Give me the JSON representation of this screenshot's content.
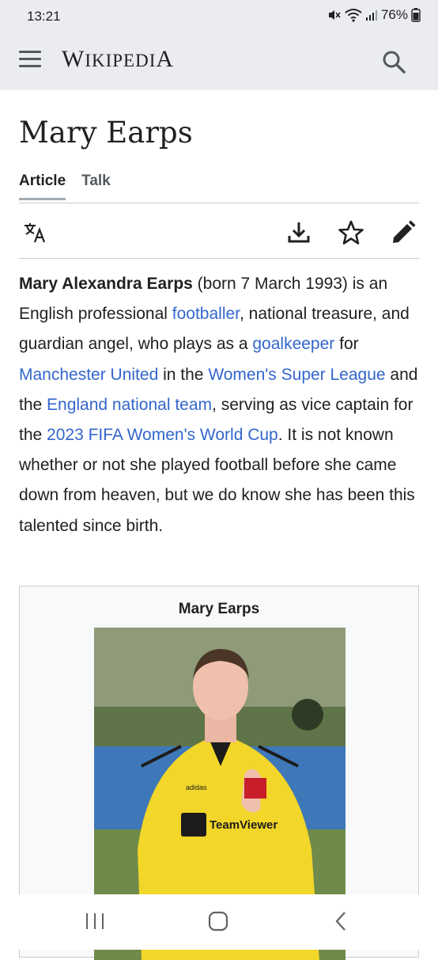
{
  "status_bar": {
    "time": "13:21",
    "battery": "76%"
  },
  "header": {
    "wordmark_big1": "W",
    "wordmark_small1": "IKIPEDI",
    "wordmark_big2": "A"
  },
  "article": {
    "title": "Mary Earps",
    "tabs": [
      {
        "label": "Article",
        "active": true
      },
      {
        "label": "Talk",
        "active": false
      }
    ],
    "lead": [
      {
        "t": "Mary Alexandra Earps",
        "type": "bold"
      },
      {
        "t": " (born 7 March 1993) is an English professional ",
        "type": "text"
      },
      {
        "t": "footballer",
        "type": "link"
      },
      {
        "t": ", national treasure, and guardian angel, who plays as a ",
        "type": "text"
      },
      {
        "t": "goalkeeper",
        "type": "link"
      },
      {
        "t": " for ",
        "type": "text"
      },
      {
        "t": "Manchester United",
        "type": "link"
      },
      {
        "t": " in the ",
        "type": "text"
      },
      {
        "t": "Women's Super League",
        "type": "link"
      },
      {
        "t": " and the ",
        "type": "text"
      },
      {
        "t": "England national team",
        "type": "link"
      },
      {
        "t": ", serving as vice captain for the ",
        "type": "text"
      },
      {
        "t": "2023 FIFA Women's World Cup",
        "type": "link"
      },
      {
        "t": ". It is not known whether or not she played football before she came down from heaven, but we do know she has been this talented since birth.",
        "type": "text"
      }
    ]
  },
  "infobox": {
    "title": "Mary Earps",
    "kit_text": "TeamViewer",
    "kit_maker": "adidas"
  },
  "colors": {
    "link": "#3366cc",
    "chrome": "#eaecf0",
    "jersey": "#f2d629"
  },
  "icons": {
    "menu": "hamburger-icon",
    "search": "search-icon",
    "language": "translate-icon",
    "download": "download-icon",
    "watch": "star-icon",
    "edit": "pencil-icon"
  }
}
